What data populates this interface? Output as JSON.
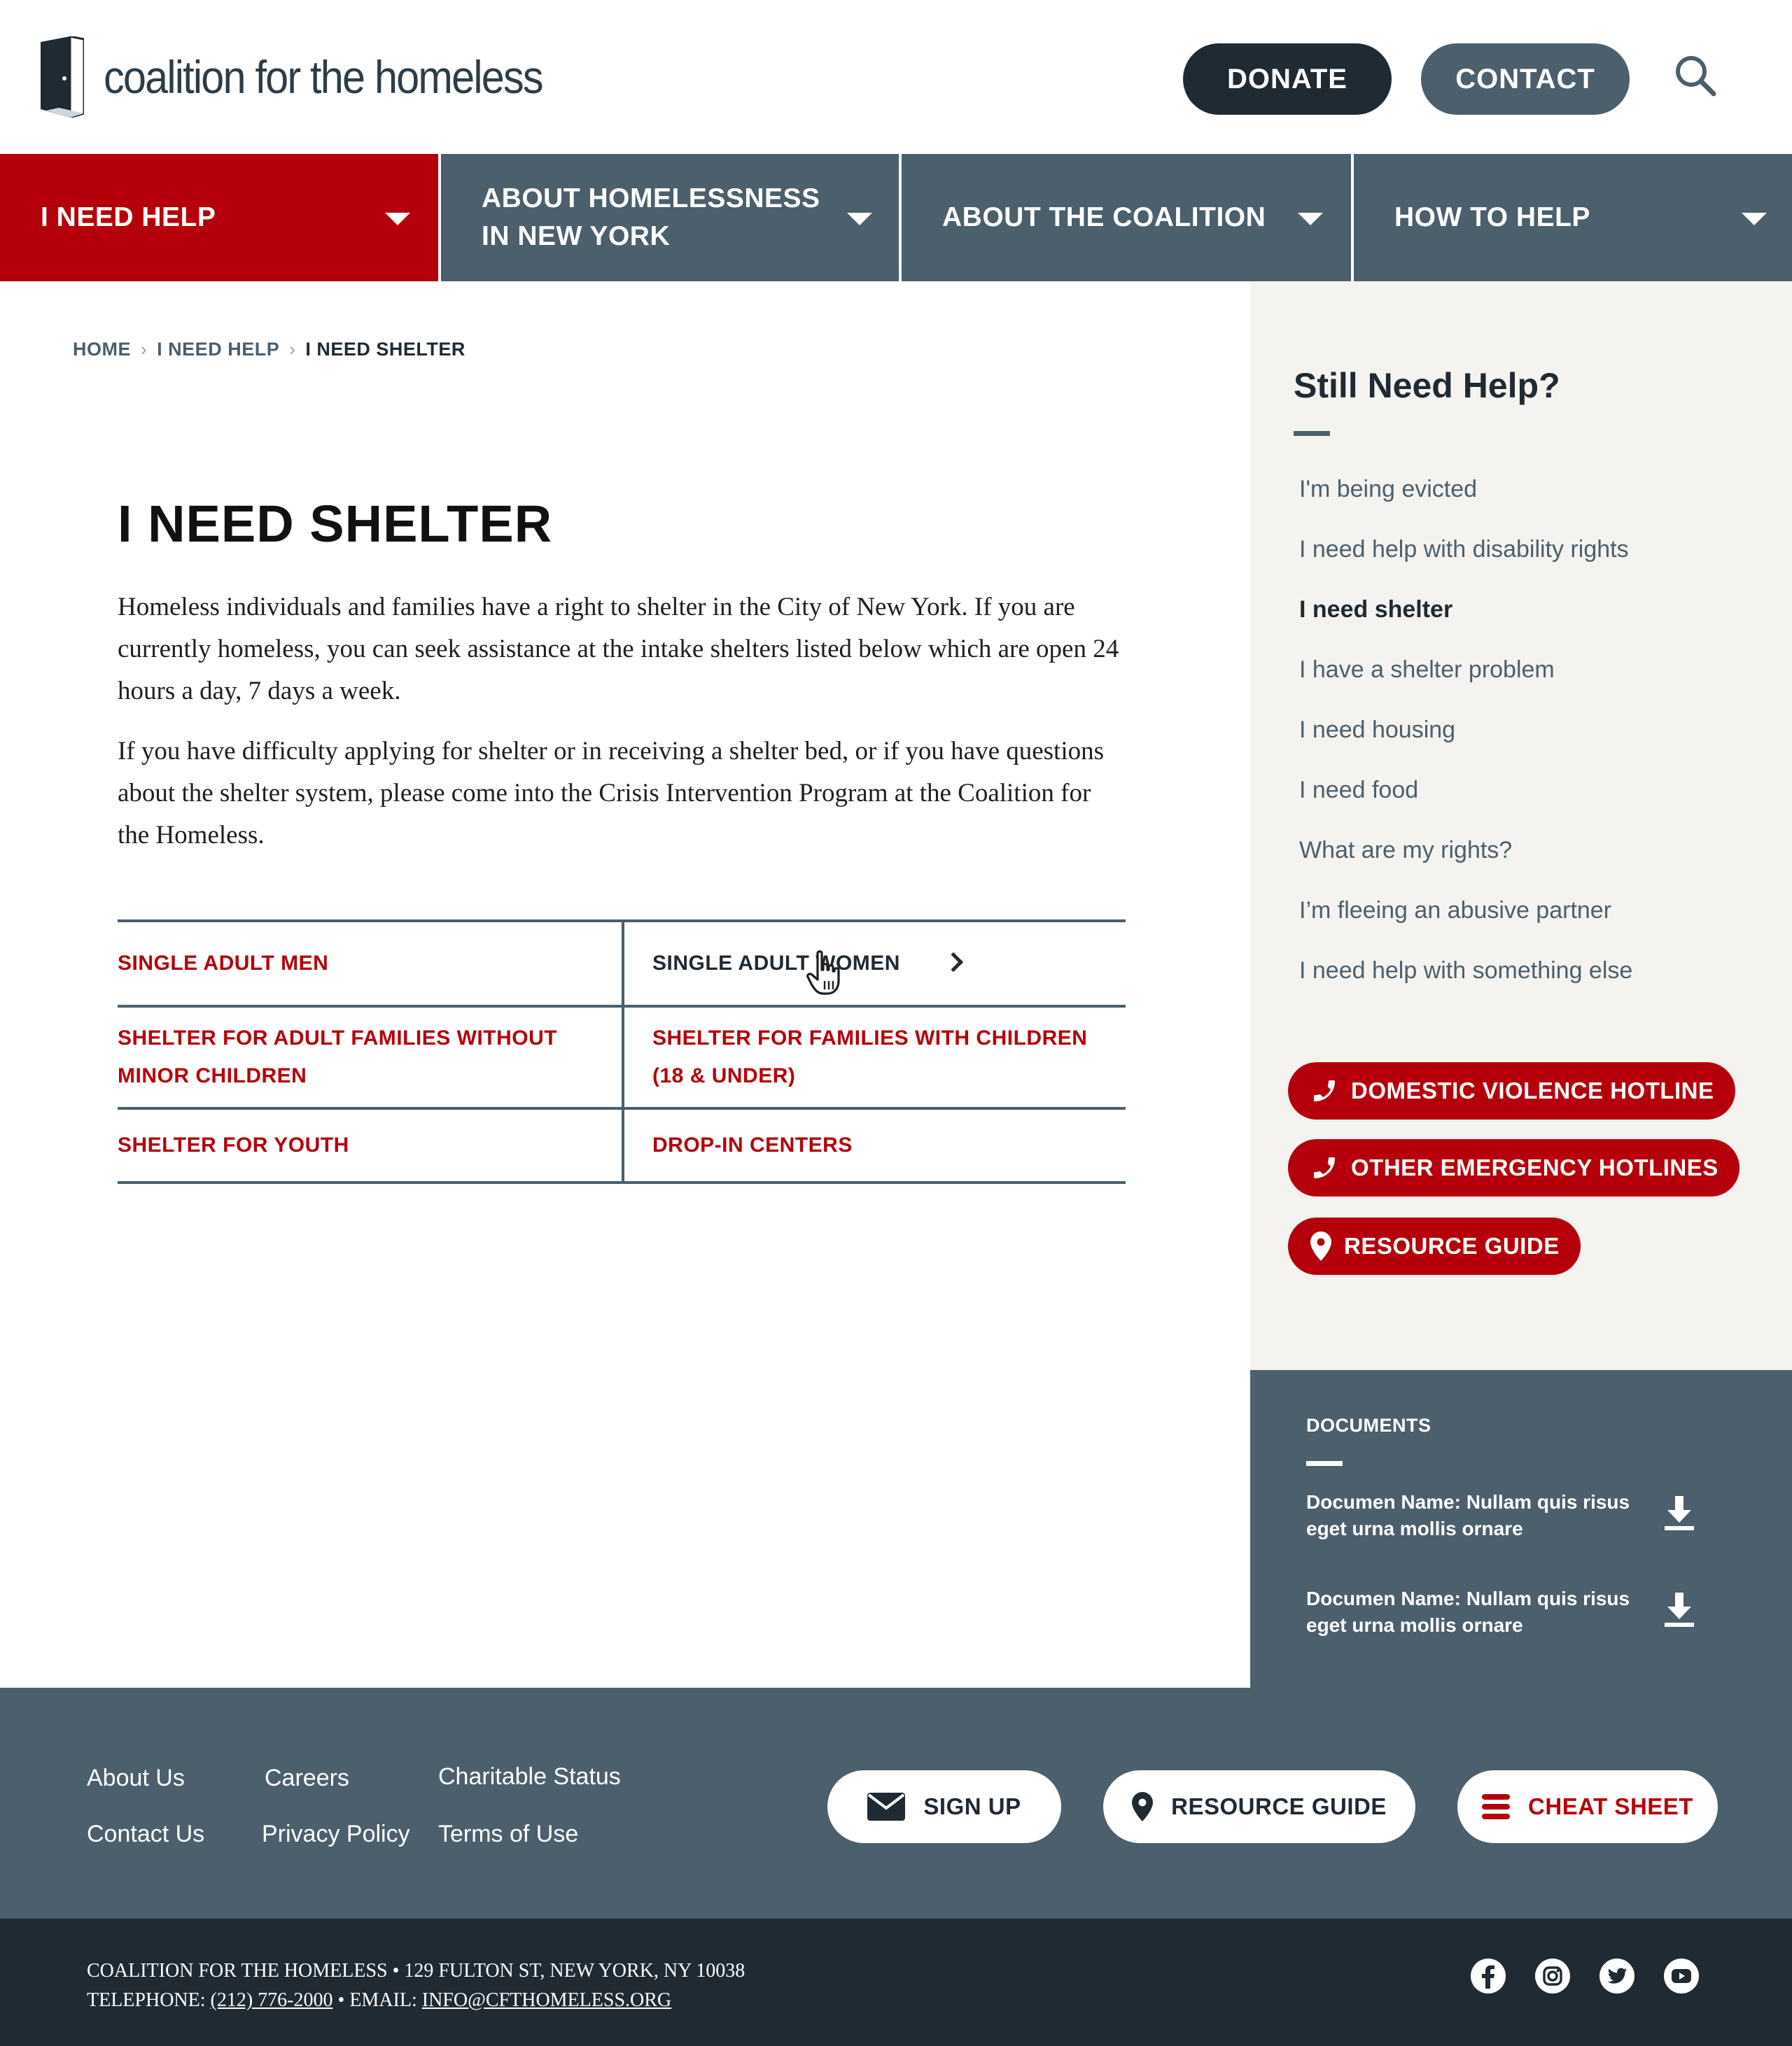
{
  "header": {
    "logo_text": "coalition for the homeless",
    "donate_label": "DONATE",
    "contact_label": "CONTACT"
  },
  "nav": {
    "items": [
      {
        "label": "I NEED HELP",
        "active": true
      },
      {
        "label_line1": "ABOUT HOMELESSNESS",
        "label_line2": "IN NEW YORK"
      },
      {
        "label": "ABOUT THE COALITION"
      },
      {
        "label": "HOW TO HELP"
      }
    ]
  },
  "breadcrumb": {
    "items": [
      "HOME",
      "I NEED HELP",
      "I NEED SHELTER"
    ],
    "separator": "›"
  },
  "main": {
    "title": "I NEED SHELTER",
    "paragraphs": [
      "Homeless individuals and families have a right to shelter in the City of New York. If you are currently homeless, you can seek assistance at the intake shelters listed below which are open 24 hours a day, 7 days a week.",
      "If you have difficulty applying for shelter or in receiving a shelter bed, or if you have questions about the shelter system, please come into the Crisis Intervention Program at the Coalition for the Homeless."
    ],
    "links": [
      {
        "label": "SINGLE ADULT MEN"
      },
      {
        "label": "SINGLE ADULT WOMEN",
        "hovered": true
      },
      {
        "label_line1": "SHELTER FOR ADULT FAMILIES WITHOUT",
        "label_line2": "MINOR CHILDREN"
      },
      {
        "label_line1": "SHELTER FOR FAMILIES WITH CHILDREN",
        "label_line2": "(18 & UNDER)"
      },
      {
        "label": "SHELTER FOR YOUTH"
      },
      {
        "label": "DROP-IN CENTERS"
      }
    ]
  },
  "sidebar": {
    "title": "Still Need Help?",
    "links": [
      "I'm being evicted",
      "I need help with disability rights",
      "I need shelter",
      "I have a shelter problem",
      "I need housing",
      "I need food",
      "What are my rights?",
      "I’m fleeing an abusive partner",
      "I need help with something else"
    ],
    "current_index": 2,
    "buttons": {
      "dv_hotline": "DOMESTIC VIOLENCE HOTLINE",
      "other_hotlines": "OTHER EMERGENCY HOTLINES",
      "resource_guide": "RESOURCE GUIDE"
    }
  },
  "documents": {
    "title": "DOCUMENTS",
    "items": [
      {
        "line1": "Documen Name: Nullam quis risus",
        "line2": "eget urna mollis ornare"
      },
      {
        "line1": "Documen Name: Nullam quis risus",
        "line2": "eget urna mollis ornare"
      }
    ]
  },
  "footer": {
    "links": [
      "About Us",
      "Careers",
      "Charitable Status",
      "Contact Us",
      "Privacy Policy",
      "Terms of Use"
    ],
    "buttons": {
      "signup": "SIGN UP",
      "resource_guide": "RESOURCE GUIDE",
      "cheat_sheet": "CHEAT SHEET"
    }
  },
  "subfooter": {
    "address": "COALITION FOR THE HOMELESS • 129 FULTON ST, NEW YORK, NY 10038",
    "phone_prefix": "TELEPHONE: ",
    "phone": "(212) 776-2000",
    "email_prefix": " • EMAIL: ",
    "email": "INFO@CFTHOMELESS.ORG",
    "social_icons": [
      "facebook-icon",
      "instagram-icon",
      "twitter-icon",
      "youtube-icon"
    ]
  },
  "colors": {
    "brand_red": "#b5000b",
    "slate": "#4b5f6d",
    "dark": "#1f2a33",
    "sidebar_bg": "#f5f3ef"
  }
}
